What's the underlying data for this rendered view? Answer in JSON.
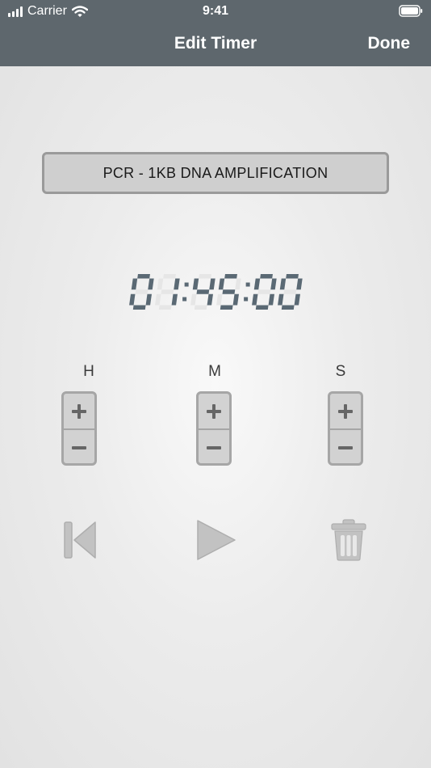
{
  "status_bar": {
    "carrier": "Carrier",
    "time": "9:41"
  },
  "nav": {
    "title": "Edit Timer",
    "done_label": "Done"
  },
  "timer": {
    "name": "PCR - 1KB DNA AMPLIFICATION",
    "digits": [
      "0",
      "1",
      "4",
      "5",
      "0",
      "0"
    ]
  },
  "units": {
    "hours": "H",
    "minutes": "M",
    "seconds": "S"
  },
  "icons": {
    "increment": "plus-icon",
    "decrement": "minus-icon",
    "reset": "skip-back-icon",
    "start": "play-icon",
    "delete": "trash-icon"
  },
  "colors": {
    "nav_bg": "#5e676d",
    "digit": "#5a6974",
    "digit_ghost": "#e6e6e6",
    "control": "#c2c2c2"
  }
}
